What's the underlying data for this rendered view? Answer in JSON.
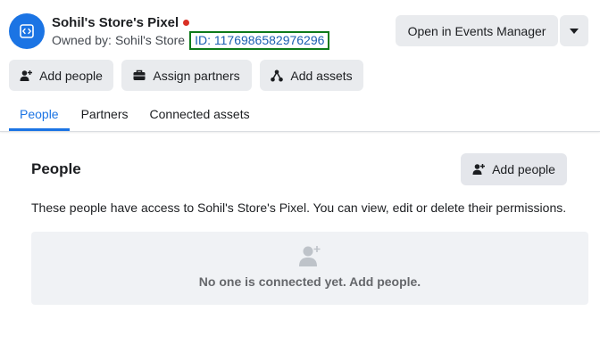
{
  "header": {
    "title": "Sohil's Store's Pixel",
    "owned_label": "Owned by:",
    "owned_value": "Sohil's Store",
    "id_text": "ID: 1176986582976296",
    "status_color": "#d93025",
    "accent_color": "#1b74e4"
  },
  "actions": {
    "open_events_label": "Open in Events Manager",
    "add_people_label": "Add people",
    "assign_partners_label": "Assign partners",
    "add_assets_label": "Add assets"
  },
  "tabs": [
    {
      "label": "People",
      "active": true
    },
    {
      "label": "Partners",
      "active": false
    },
    {
      "label": "Connected assets",
      "active": false
    }
  ],
  "people_section": {
    "title": "People",
    "add_button_label": "Add people",
    "description": "These people have access to Sohil's Store's Pixel. You can view, edit or delete their permissions.",
    "empty_message": "No one is connected yet. Add people."
  },
  "icons": {
    "pixel": "code-icon",
    "dropdown": "caret-down-icon",
    "add_person": "add-person-icon",
    "briefcase": "briefcase-icon",
    "assets": "network-icon",
    "empty": "person-placeholder-icon"
  }
}
